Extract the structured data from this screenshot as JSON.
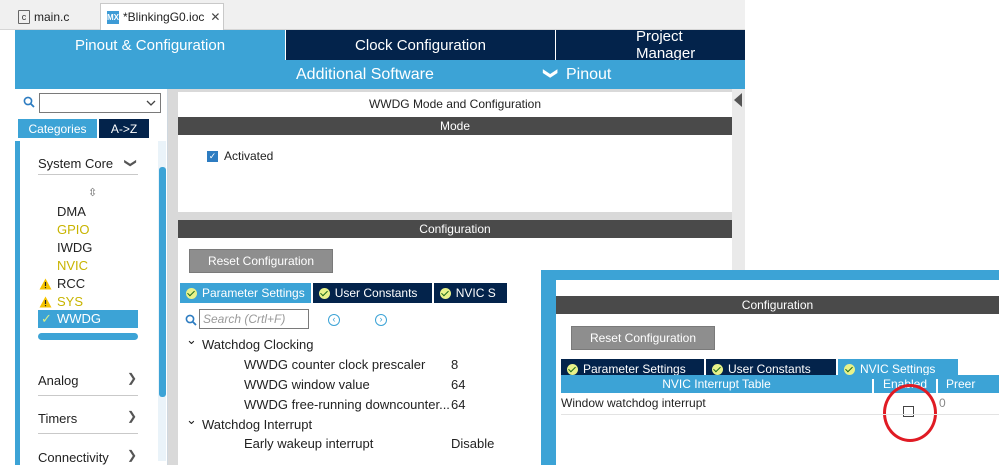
{
  "editor_tabs": [
    {
      "label": "main.c",
      "icon": "c-file-icon"
    },
    {
      "label": "*BlinkingG0.ioc",
      "icon": "mx-icon",
      "icon_text": "MX",
      "close": "✕"
    }
  ],
  "top_nav": {
    "tabs": [
      "Pinout & Configuration",
      "Clock Configuration",
      "Project Manager"
    ],
    "sub": {
      "additional_software": "Additional Software",
      "pinout": "Pinout",
      "pinout_chevron": "❯"
    }
  },
  "left_panel": {
    "category_tabs": [
      "Categories",
      "A->Z"
    ],
    "system_core": {
      "label": "System Core",
      "chevron": "❯"
    },
    "sort_icon": "⇳",
    "items": [
      "DMA",
      "GPIO",
      "IWDG",
      "NVIC",
      "RCC",
      "SYS",
      "WWDG"
    ],
    "sections": [
      {
        "label": "Analog",
        "chevron": "❯"
      },
      {
        "label": "Timers",
        "chevron": "❯"
      },
      {
        "label": "Connectivity",
        "chevron": "❯"
      }
    ],
    "check": "✓"
  },
  "mode_panel": {
    "title": "WWDG Mode and Configuration",
    "mode_header": "Mode",
    "activated_label": "Activated",
    "activated_check": "✓"
  },
  "config_panel": {
    "header": "Configuration",
    "reset_button": "Reset Configuration",
    "tabs": [
      "Parameter Settings",
      "User Constants",
      "NVIC S"
    ],
    "search_placeholder": "Search (Crtl+F)",
    "prev": "‹",
    "next": "›",
    "watchdog_clocking": {
      "label": "Watchdog Clocking",
      "toggle": "⌄",
      "params": [
        {
          "name": "WWDG counter clock prescaler",
          "value": "8"
        },
        {
          "name": "WWDG window value",
          "value": "64"
        },
        {
          "name": "WWDG free-running downcounter...",
          "value": "64"
        }
      ]
    },
    "watchdog_interrupt": {
      "label": "Watchdog Interrupt",
      "toggle": "⌄",
      "params": [
        {
          "name": "Early wakeup interrupt",
          "value": "Disable"
        }
      ]
    }
  },
  "overlay": {
    "header": "Configuration",
    "reset_button": "Reset Configuration",
    "tabs": [
      "Parameter Settings",
      "User Constants",
      "NVIC Settings"
    ],
    "table_headers": [
      "NVIC Interrupt Table",
      "Enabled",
      "Preer"
    ],
    "row": {
      "name": "Window watchdog interrupt",
      "preemption": "0"
    }
  },
  "colors": {
    "accent": "#3ca3d6",
    "navy": "#03234b",
    "warning": "#f5c400",
    "highlight": "#e01b24"
  }
}
